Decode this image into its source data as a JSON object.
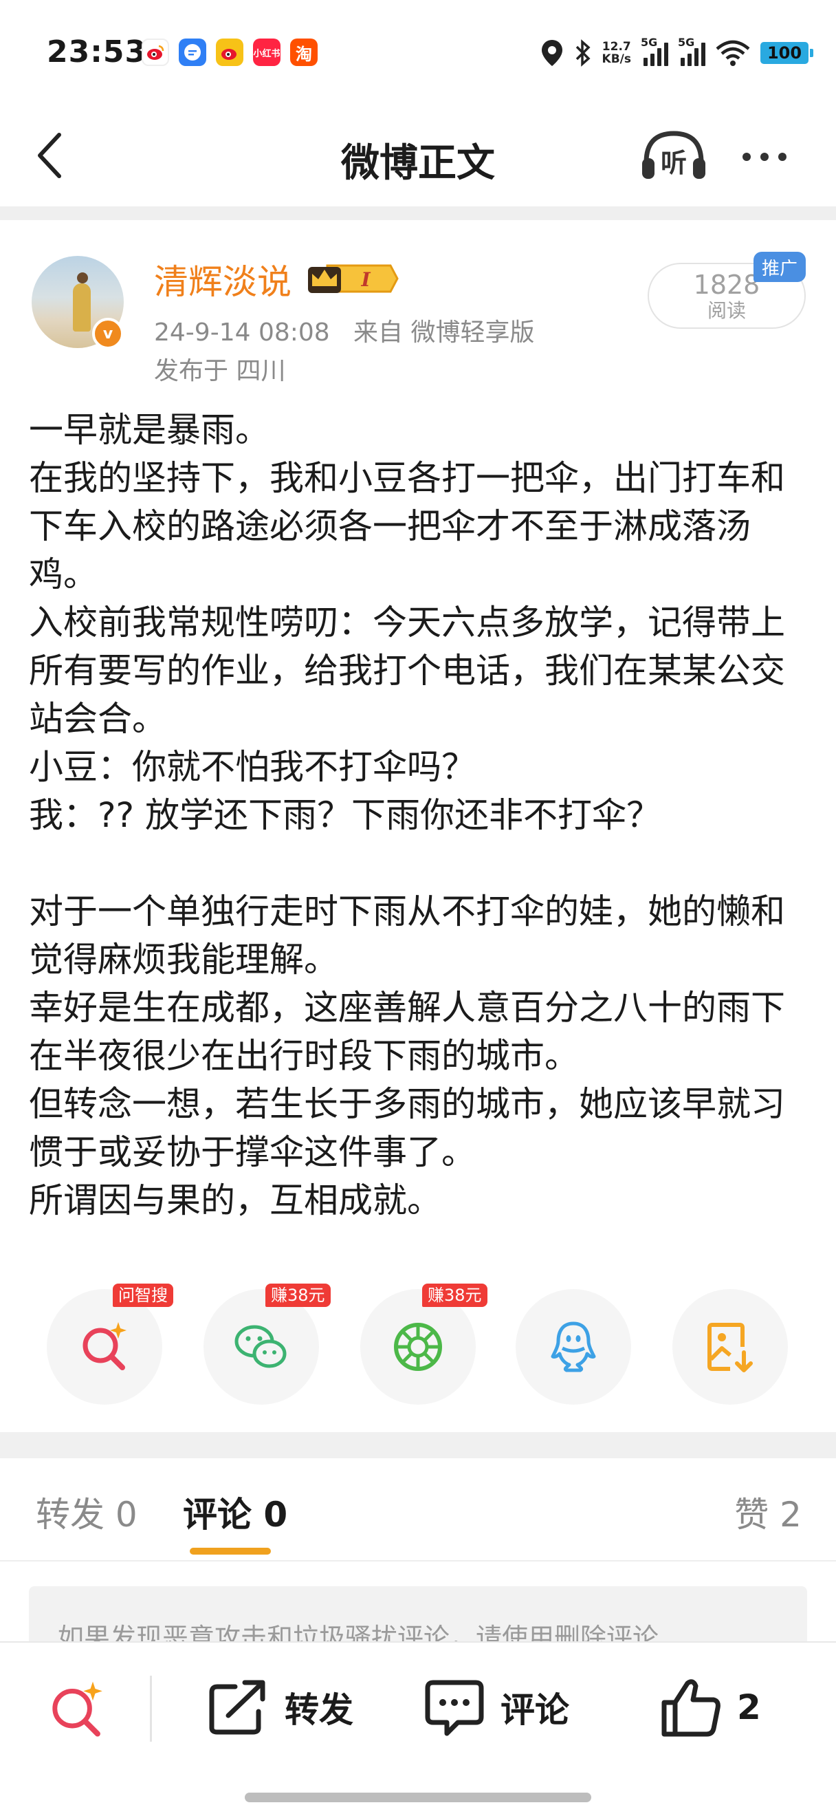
{
  "status_bar": {
    "time": "23:53",
    "notification_icons": [
      {
        "name": "weibo-icon",
        "bg": "#ffffff",
        "fg": "#e6162d",
        "label": ""
      },
      {
        "name": "message-icon",
        "bg": "#2f7ff5",
        "fg": "#ffffff",
        "label": ""
      },
      {
        "name": "weibo-lite-icon",
        "bg": "#f7c217",
        "fg": "#e6162d",
        "label": ""
      },
      {
        "name": "xiaohongshu-icon",
        "bg": "#ff2442",
        "fg": "#ffffff",
        "label": "小红书"
      },
      {
        "name": "taobao-icon",
        "bg": "#ff5000",
        "fg": "#ffffff",
        "label": "淘"
      }
    ],
    "net_speed_value": "12.7",
    "net_speed_unit": "KB/s",
    "signal1_label": "5G",
    "signal2_label": "5G",
    "battery": "100"
  },
  "nav": {
    "title": "微博正文",
    "listen_label": "听"
  },
  "author": {
    "name": "清辉淡说",
    "level_badge": "I",
    "verified_mark": "v",
    "datetime": "24-9-14 08:08",
    "source": "来自 微博轻享版",
    "location": "发布于 四川",
    "read_count": "1828",
    "read_label": "阅读",
    "promo_tag": "推广"
  },
  "post": {
    "paragraphs": [
      "一早就是暴雨。",
      "在我的坚持下，我和小豆各打一把伞，出门打车和下车入校的路途必须各一把伞才不至于淋成落汤鸡。",
      "入校前我常规性唠叨：今天六点多放学，记得带上所有要写的作业，给我打个电话，我们在某某公交站会合。",
      "小豆：你就不怕我不打伞吗？",
      "我：?? 放学还下雨？下雨你还非不打伞？",
      "",
      "对于一个单独行走时下雨从不打伞的娃，她的懒和觉得麻烦我能理解。",
      "幸好是生在成都，这座善解人意百分之八十的雨下在半夜很少在出行时段下雨的城市。",
      "但转念一想，若生长于多雨的城市，她应该早就习惯于或妥协于撑伞这件事了。",
      "所谓因与果的，互相成就。"
    ]
  },
  "share": {
    "items": [
      {
        "name": "wenzhisou",
        "tag": "问智搜"
      },
      {
        "name": "wechat",
        "tag": "赚38元"
      },
      {
        "name": "moments",
        "tag": "赚38元"
      },
      {
        "name": "qq",
        "tag": ""
      },
      {
        "name": "save-image",
        "tag": ""
      }
    ]
  },
  "tabs": {
    "repost": "转发 0",
    "comment": "评论 0",
    "like": "赞 2"
  },
  "notice": "如果发现恶意攻击和垃圾骚扰评论，请使用删除评论",
  "bottom_bar": {
    "repost_label": "转发",
    "comment_label": "评论",
    "like_count": "2"
  },
  "colors": {
    "accent_orange": "#f0801b",
    "tab_underline": "#f0a11e",
    "promo_blue": "#4a8fe2",
    "tag_red": "#ef3b36"
  }
}
